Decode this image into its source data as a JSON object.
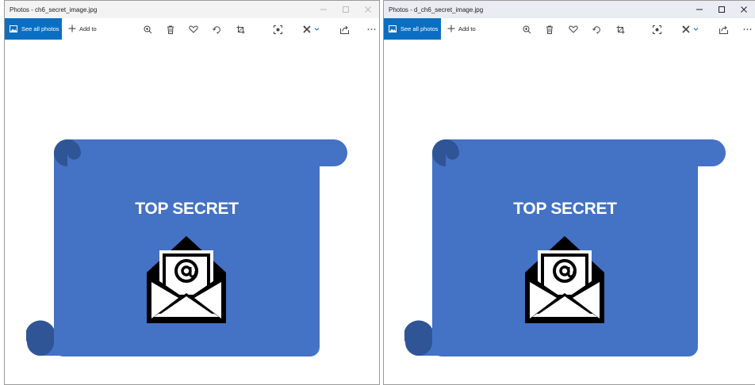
{
  "windows": [
    {
      "title": "Photos - ch6_secret_image.jpg",
      "active": false,
      "toolbar": {
        "see_all_label": "See all photos",
        "add_to_label": "Add to"
      },
      "image_text": "TOP SECRET"
    },
    {
      "title": "Photos - d_ch6_secret_image.jpg",
      "active": true,
      "toolbar": {
        "see_all_label": "See all photos",
        "add_to_label": "Add to"
      },
      "image_text": "TOP SECRET"
    }
  ],
  "toolbar_icons": [
    "zoom-icon",
    "delete-icon",
    "heart-icon",
    "rotate-icon",
    "crop-icon",
    "enhance-icon",
    "edit-create-icon",
    "share-icon",
    "more-icon"
  ],
  "colors": {
    "accent": "#0a6fc2",
    "scroll_blue": "#4472c4",
    "scroll_shadow": "#2f5597"
  }
}
